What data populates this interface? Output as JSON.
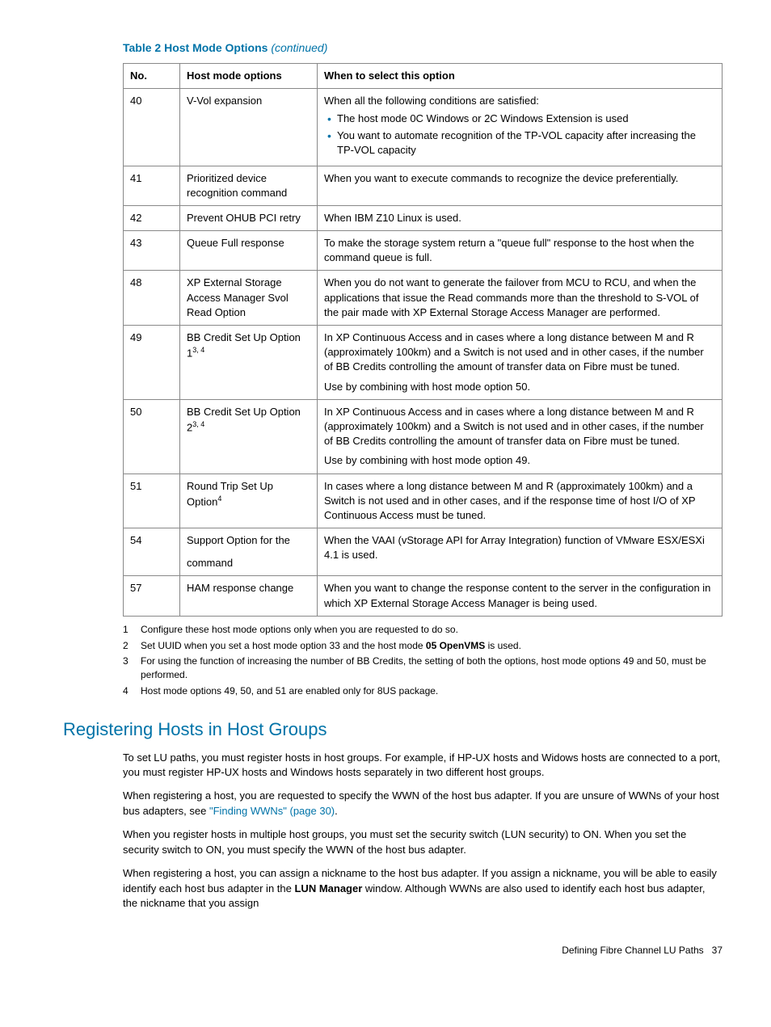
{
  "table": {
    "title_prefix": "Table 2 Host Mode Options ",
    "title_suffix": "(continued)",
    "headers": {
      "no": "No.",
      "opt": "Host mode options",
      "when": "When to select this option"
    },
    "rows": [
      {
        "no": "40",
        "opt": "V-Vol expansion",
        "when_lead": "When all the following conditions are satisfied:",
        "bullets": [
          "The host mode 0C Windows or 2C Windows Extension is used",
          "You want to automate recognition of the TP-VOL capacity after increasing the TP-VOL capacity"
        ]
      },
      {
        "no": "41",
        "opt": "Prioritized device recognition command",
        "when": "When you want to execute commands to recognize the device preferentially."
      },
      {
        "no": "42",
        "opt": "Prevent OHUB PCI retry",
        "when": "When IBM Z10 Linux is used."
      },
      {
        "no": "43",
        "opt": "Queue Full response",
        "when": "To make the storage system return a \"queue full\" response to the host when the command queue is full."
      },
      {
        "no": "48",
        "opt": "XP External Storage Access Manager Svol Read Option",
        "when": "When you do not want to generate the failover from MCU to RCU, and when the applications that issue the Read commands more than the threshold to S-VOL of the pair made with XP External Storage Access Manager are performed."
      },
      {
        "no": "49",
        "opt_pre": "BB Credit Set Up Option 1",
        "opt_sup": "3, 4",
        "when": "In XP Continuous Access and in cases where a long distance between M and R (approximately 100km) and a Switch is not used and in other cases, if the number of BB Credits controlling the amount of transfer data on Fibre must be tuned.",
        "when2": "Use by combining with host mode option 50."
      },
      {
        "no": "50",
        "opt_pre": "BB Credit Set Up Option 2",
        "opt_sup": "3, 4",
        "when": "In XP Continuous Access and in cases where a long distance between M and R (approximately 100km) and a Switch is not used and in other cases, if the number of BB Credits controlling the amount of transfer data on Fibre must be tuned.",
        "when2": "Use by combining with host mode option 49."
      },
      {
        "no": "51",
        "opt_pre": "Round Trip Set Up Option",
        "opt_sup": "4",
        "when": "In cases where a long distance between M and R (approximately 100km) and a Switch is not used and in other cases, and if the response time of host I/O of XP Continuous Access must be tuned."
      },
      {
        "no": "54",
        "opt": "Support Option for the",
        "opt_line2": "command",
        "when": "When the VAAI (vStorage API for Array Integration) function of VMware ESX/ESXi 4.1 is used."
      },
      {
        "no": "57",
        "opt": "HAM response change",
        "when": "When you want to change the response content to the server in the configuration in which XP External Storage Access Manager is being used."
      }
    ]
  },
  "footnotes": [
    {
      "n": "1",
      "t": "Configure these host mode options only when you are requested to do so."
    },
    {
      "n": "2",
      "t_pre": "Set UUID when you set a host mode option 33 and the host mode ",
      "t_bold": "05 OpenVMS",
      "t_post": " is used."
    },
    {
      "n": "3",
      "t": "For using the function of increasing the number of BB Credits, the setting of both the options, host mode options 49 and 50, must be performed."
    },
    {
      "n": "4",
      "t": "Host mode options 49, 50, and 51 are enabled only for 8US package."
    }
  ],
  "section_heading": "Registering Hosts in Host Groups",
  "p1": "To set LU paths, you must register hosts in host groups. For example, if HP-UX hosts and Widows hosts are connected to a port, you must register HP-UX hosts and Windows hosts separately in two different host groups.",
  "p2a": "When registering a host, you are requested to specify the WWN of the host bus adapter. If you are unsure of WWNs of your host bus adapters, see ",
  "p2link": "\"Finding WWNs\" (page 30)",
  "p2b": ".",
  "p3": "When you register hosts in multiple host groups, you must set the security switch (LUN security) to ON. When you set the security switch to ON, you must specify the WWN of the host bus adapter.",
  "p4a": "When registering a host, you can assign a nickname to the host bus adapter. If you assign a nickname, you will be able to easily identify each host bus adapter in the ",
  "p4bold": "LUN Manager",
  "p4b": " window. Although WWNs are also used to identify each host bus adapter, the nickname that you assign",
  "footer": {
    "label": "Defining Fibre Channel LU Paths",
    "page": "37"
  }
}
